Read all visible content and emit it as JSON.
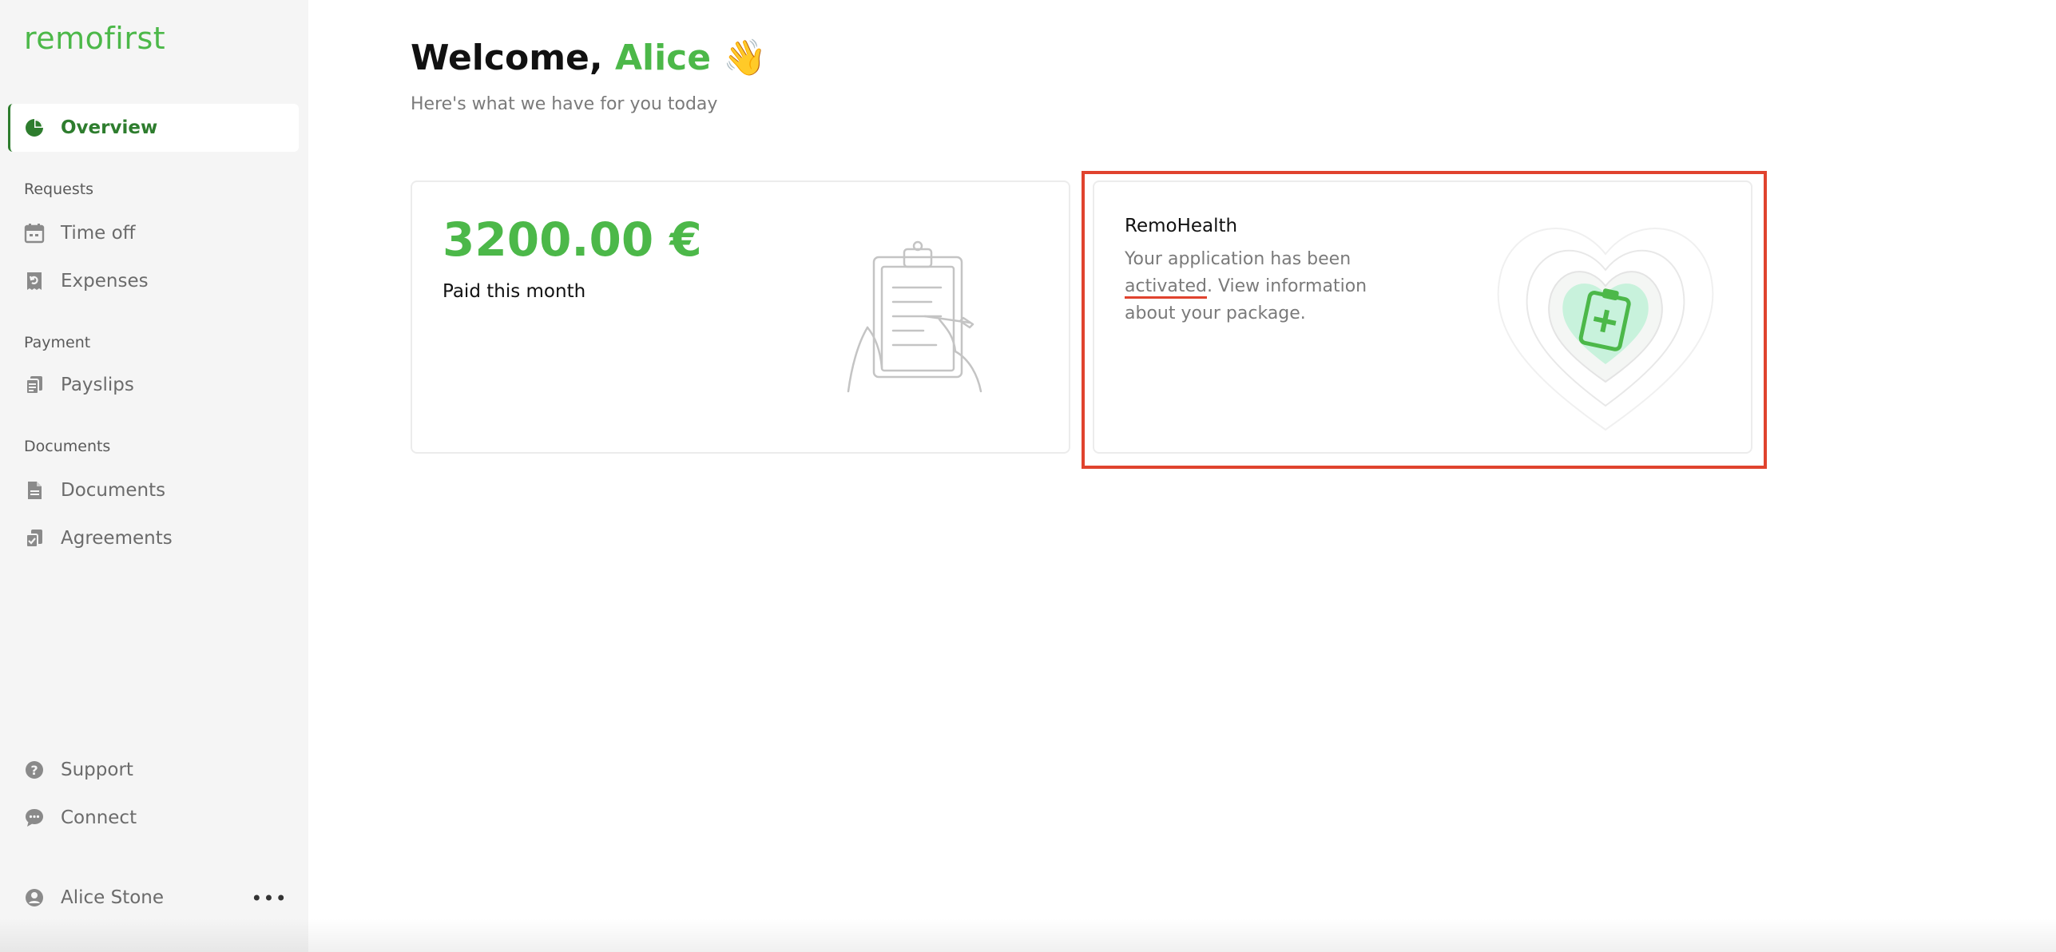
{
  "brand": {
    "logo_text": "remofirst",
    "accent_color": "#4cb849",
    "active_color": "#2e7d2e"
  },
  "sidebar": {
    "overview": {
      "label": "Overview",
      "icon": "pie-chart-icon"
    },
    "sections": {
      "requests": "Requests",
      "payment": "Payment",
      "documents": "Documents"
    },
    "items": {
      "time_off": {
        "label": "Time off",
        "icon": "calendar-icon"
      },
      "expenses": {
        "label": "Expenses",
        "icon": "receipt-icon"
      },
      "payslips": {
        "label": "Payslips",
        "icon": "payslips-icon"
      },
      "documents": {
        "label": "Documents",
        "icon": "document-icon"
      },
      "agreements": {
        "label": "Agreements",
        "icon": "agreements-icon"
      },
      "support": {
        "label": "Support",
        "icon": "help-icon"
      },
      "connect": {
        "label": "Connect",
        "icon": "chat-icon"
      }
    },
    "user": {
      "name": "Alice Stone",
      "icon": "user-icon",
      "more_label": "•••"
    }
  },
  "main": {
    "welcome_prefix": "Welcome,",
    "welcome_name": "Alice",
    "welcome_emoji": "👋",
    "subtitle": "Here's what we have for you today",
    "paid_card": {
      "amount": "3200.00 €",
      "label": "Paid this month",
      "illustration": "clipboard-illustration"
    },
    "health_card": {
      "title": "RemoHealth",
      "desc_part1": "Your application has been ",
      "desc_highlight": "activated",
      "desc_part2": ". View information about your package.",
      "illustration": "health-heart-illustration",
      "highlight_color": "#e0432e"
    }
  }
}
